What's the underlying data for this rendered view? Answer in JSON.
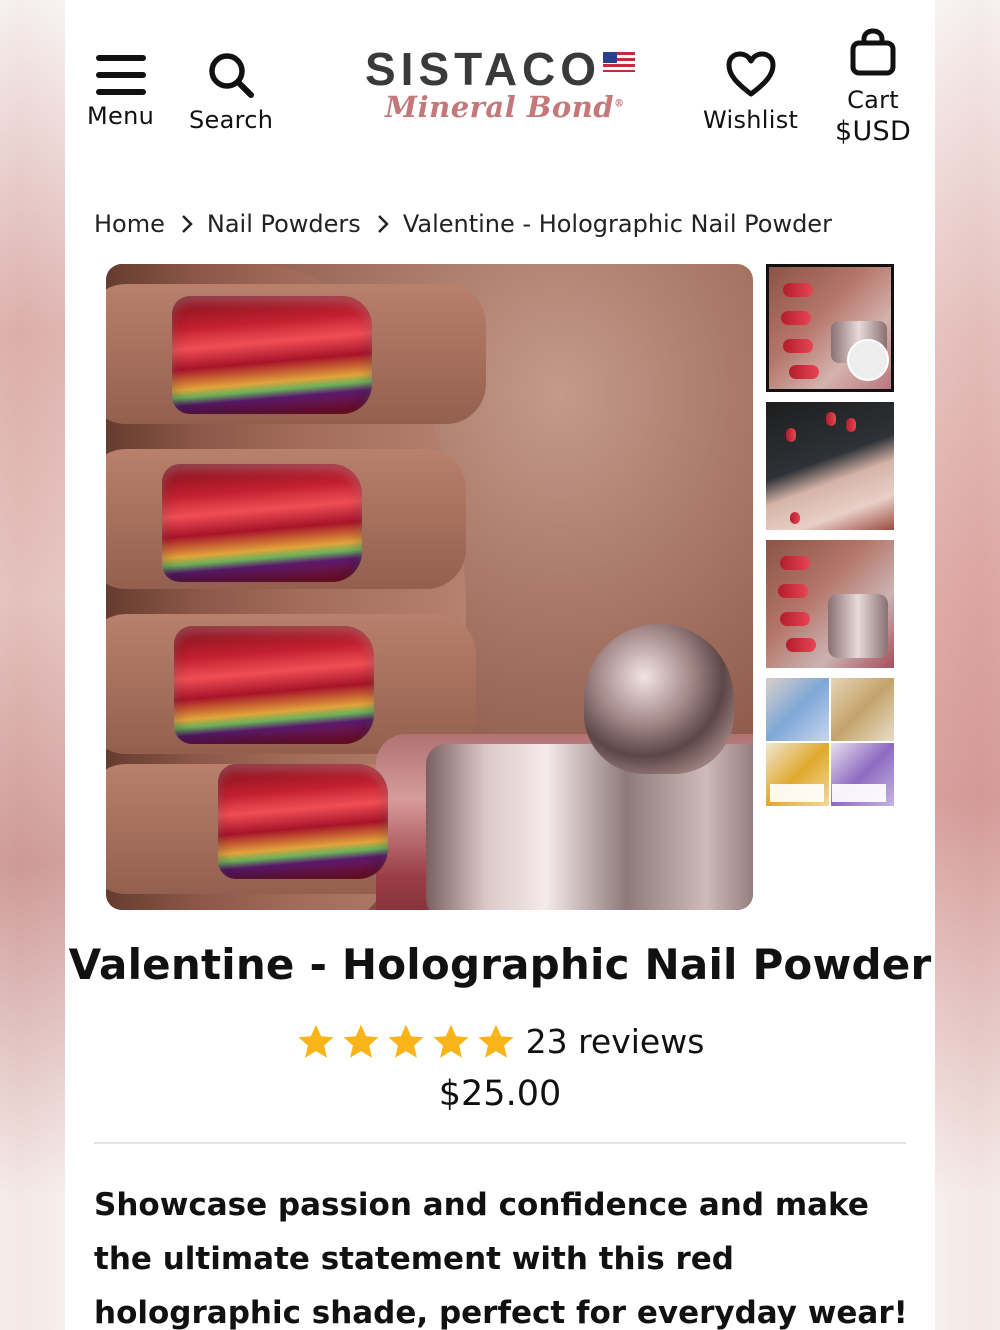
{
  "header": {
    "menu_label": "Menu",
    "search_label": "Search",
    "wishlist_label": "Wishlist",
    "cart_label": "Cart",
    "currency": "$USD",
    "logo_main": "SISTACO",
    "logo_sub": "Mineral Bond",
    "logo_reg": "®"
  },
  "breadcrumb": [
    "Home",
    "Nail Powders",
    "Valentine - Holographic Nail Powder"
  ],
  "gallery": {
    "thumbnails": [
      "thumb-1",
      "thumb-2",
      "thumb-3",
      "thumb-4"
    ],
    "active_thumb": 0
  },
  "product": {
    "title": "Valentine - Holographic Nail Powder",
    "rating": 5,
    "reviews": "23 reviews",
    "price": "$25.00",
    "description": "Showcase passion and confidence and make the ultimate statement with this red holographic shade, perfect for everyday wear!"
  },
  "colors": {
    "star": "#f8b418",
    "logo_accent": "#c4787a",
    "text": "#111111"
  },
  "icons": {
    "menu": "hamburger-icon",
    "search": "search-icon",
    "wishlist": "heart-icon",
    "cart": "bag-icon",
    "breadcrumb_sep": "chevron-right-icon",
    "rating": "star-icon"
  }
}
